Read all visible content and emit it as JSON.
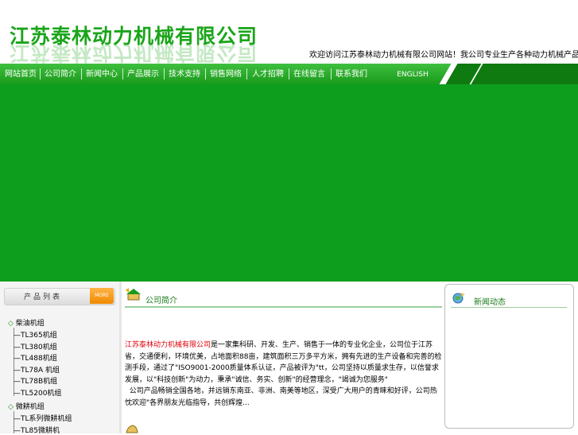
{
  "header": {
    "company_name": "江苏泰林动力机械有限公司",
    "marquee": "欢迎访问江苏泰林动力机械有限公司网站！我公司专业生产各种动力机械产品，质量可靠，价格合理，欢迎新老客户来电洽谈业务！"
  },
  "nav": {
    "items": [
      "网站首页",
      "公司简介",
      "新闻中心",
      "产品展示",
      "技术支持",
      "销售网络",
      "人才招聘",
      "在线留言",
      "联系我们"
    ],
    "english": "ENGLISH"
  },
  "products": {
    "title": "产品列表",
    "more": "MORE",
    "categories": [
      {
        "name": "柴油机组",
        "items": [
          "TL365机组",
          "TL380机组",
          "TL488机组",
          "TL78A 机组",
          "TL78B机组",
          "TL5200机组"
        ]
      },
      {
        "name": "微耕机组",
        "items": [
          "TL系列微耕机组",
          "TL85微耕机"
        ]
      }
    ]
  },
  "about": {
    "title": "公司简介",
    "highlight": "江苏泰林动力机械有限公司",
    "line1": "是一家集科研、开发、生产、销售于一体的专业化企业，公司位于江苏省，交通便利，环境优美，占地面积",
    "line2": "88亩，建筑面积三万多平方米，拥有先进的生产设备和完善的检测手段，通过了",
    "iso": "ISO9001-2000",
    "line3": "质量体系认证，产品被评为",
    "tt": "tt",
    "line4": "，公司坚持以质量求生存，以信誉求发展，以",
    "quote1": "科技创新",
    "line5": "为动力，秉承",
    "quote2": "诚信、务实、创新",
    "line6": "的经营理念，",
    "quote3": "竭诚为您服务",
    "para2": "公司产品畅销全国各地，并远销东南亚、非洲、南美等地区，深受广大用户的青睐和好评，公司热忱欢迎",
    "para2_end": "各界朋友光临指导，共创辉煌...",
    "ellipsis": "..."
  },
  "news": {
    "title": "新闻动态"
  },
  "colors": {
    "brand_green": "#1aa51a",
    "banner_green": "#0e9e1e",
    "highlight_red": "#e0000b"
  }
}
